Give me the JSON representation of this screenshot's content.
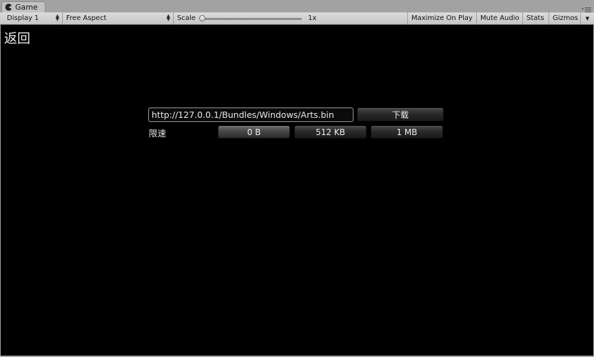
{
  "tab": {
    "title": "Game",
    "icon": "pacman-icon"
  },
  "toolbar": {
    "display": "Display 1",
    "aspect": "Free Aspect",
    "scale_label": "Scale",
    "scale_value": "1x",
    "scale_level": 0.0,
    "maximize_on_play": "Maximize On Play",
    "mute_audio": "Mute Audio",
    "stats": "Stats",
    "gizmos": "Gizmos"
  },
  "game": {
    "back_label": "返回",
    "url_value": "http://127.0.0.1/Bundles/Windows/Arts.bin",
    "download_label": "下载",
    "speed_limit_label": "限速",
    "limit_options": [
      "0 B",
      "512 KB",
      "1 MB"
    ],
    "selected_limit": "0 B"
  }
}
